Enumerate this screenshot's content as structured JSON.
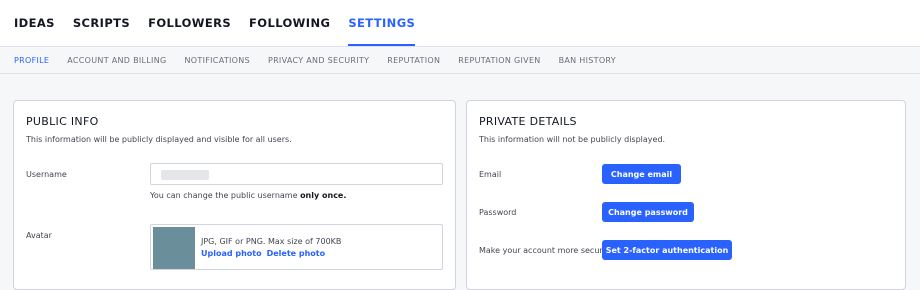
{
  "topnav": {
    "tabs": [
      {
        "label": "IDEAS"
      },
      {
        "label": "SCRIPTS"
      },
      {
        "label": "FOLLOWERS"
      },
      {
        "label": "FOLLOWING"
      },
      {
        "label": "SETTINGS",
        "active": true
      }
    ]
  },
  "subnav": {
    "tabs": [
      {
        "label": "PROFILE",
        "active": true
      },
      {
        "label": "ACCOUNT AND BILLING"
      },
      {
        "label": "NOTIFICATIONS"
      },
      {
        "label": "PRIVACY AND SECURITY"
      },
      {
        "label": "REPUTATION"
      },
      {
        "label": "REPUTATION GIVEN"
      },
      {
        "label": "BAN HISTORY"
      }
    ]
  },
  "public_info": {
    "title": "PUBLIC INFO",
    "description": "This information will be publicly displayed and visible for all users.",
    "username_label": "Username",
    "username_value": "",
    "username_hint_prefix": "You can change the public username ",
    "username_hint_bold": "only once.",
    "avatar_label": "Avatar",
    "avatar_hint": "JPG, GIF or PNG. Max size of 700KB",
    "upload_label": "Upload photo",
    "delete_label": "Delete photo"
  },
  "private_details": {
    "title": "PRIVATE DETAILS",
    "description": "This information will not be publicly displayed.",
    "email_label": "Email",
    "change_email_label": "Change email",
    "password_label": "Password",
    "change_password_label": "Change password",
    "security_label": "Make your account more secure",
    "two_factor_label": "Set 2-factor authentication"
  },
  "colors": {
    "accent": "#2962ff",
    "avatar": "#6b8f9a"
  }
}
